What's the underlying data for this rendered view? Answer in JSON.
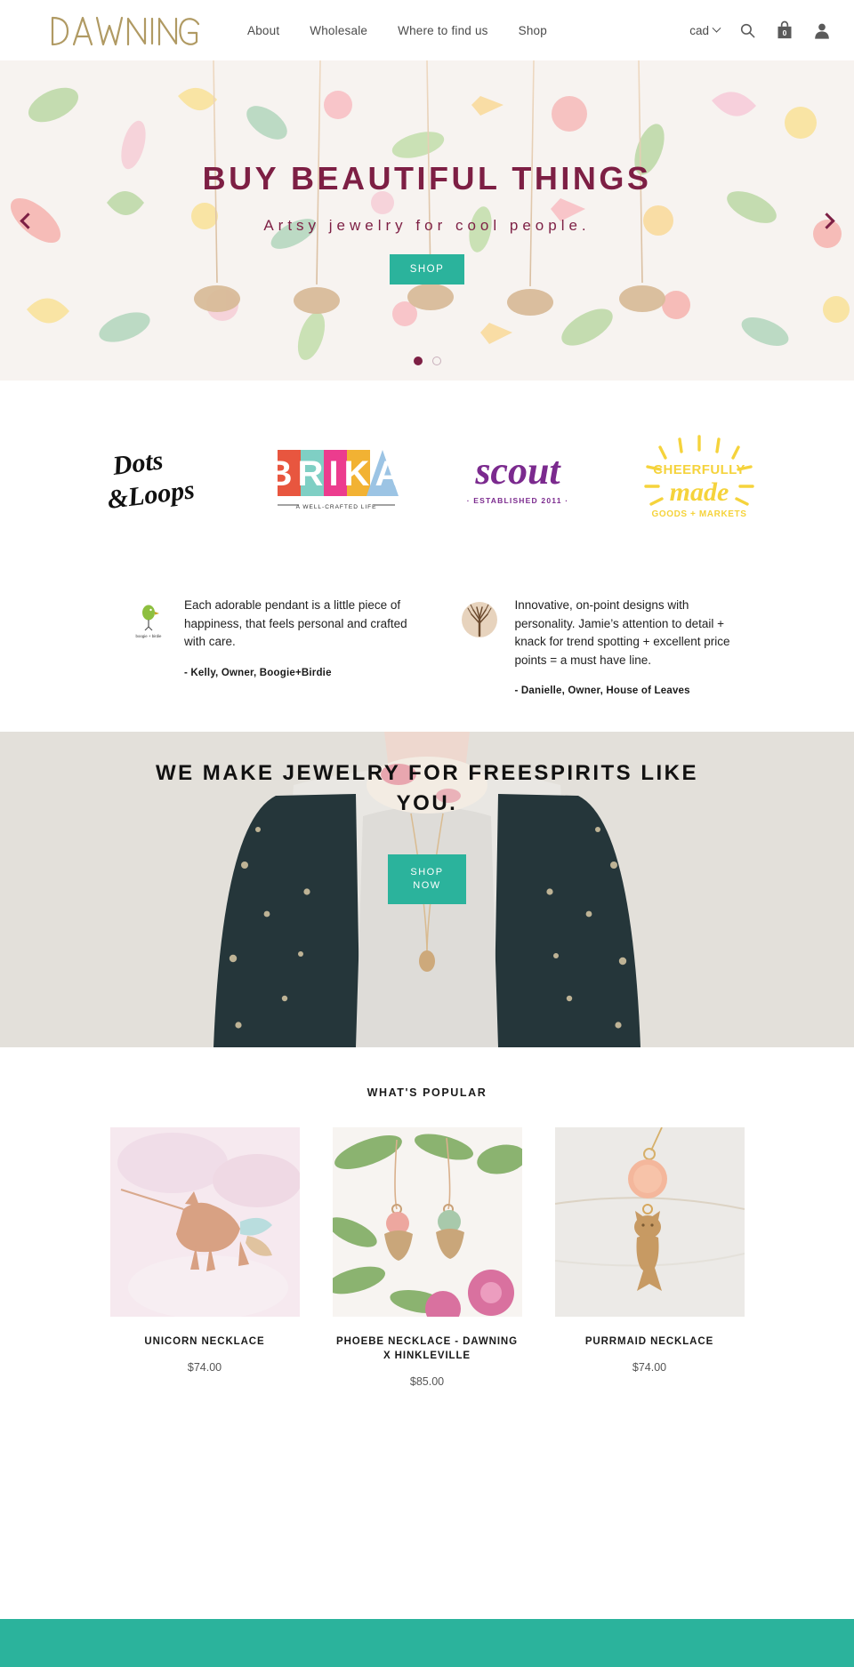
{
  "brand": {
    "name": "DAWNING"
  },
  "header": {
    "nav": [
      {
        "label": "About"
      },
      {
        "label": "Wholesale"
      },
      {
        "label": "Where to find us"
      },
      {
        "label": "Shop"
      }
    ],
    "currency": "cad",
    "icons": {
      "search": "search-icon",
      "cart": "shopping-bag-icon",
      "account": "user-account-icon"
    },
    "cart_count": "0"
  },
  "hero": {
    "title": "BUY BEAUTIFUL THINGS",
    "subtitle": "Artsy jewelry for cool people.",
    "button": "SHOP",
    "prev_icon": "chevron-left-icon",
    "next_icon": "chevron-right-icon",
    "slides": 2,
    "active_slide": 1,
    "title_color": "#7d1f44",
    "button_color": "#2bb39c"
  },
  "press_logos": [
    {
      "name": "Dots & Loops",
      "line1": "Dots",
      "line2": "&Loops"
    },
    {
      "name": "BRIKA",
      "letters": "BRIKA",
      "tagline": "A WELL-CRAFTED LIFE"
    },
    {
      "name": "scout",
      "word": "scout",
      "tagline": "· ESTABLISHED 2011 ·"
    },
    {
      "name": "Cheerfully Made",
      "line1": "CHEERFULLY",
      "line2": "made",
      "line3": "GOODS + MARKETS"
    }
  ],
  "testimonials": [
    {
      "quote": "Each adorable pendant is a little piece of happiness, that feels personal and crafted with care.",
      "author": "- Kelly, Owner, Boogie+Birdie",
      "avatar": "boogie-birdie-logo",
      "avatar_caption": "boogie + birdie"
    },
    {
      "quote": "Innovative, on-point designs with personality. Jamie’s attention to detail + knack for trend spotting + excellent price points = a must have line.",
      "author": "- Danielle, Owner, House of Leaves",
      "avatar": "house-of-leaves-tree-logo"
    }
  ],
  "lifestyle": {
    "title": "WE MAKE JEWELRY FOR FREESPIRITS LIKE YOU.",
    "button_line1": "SHOP",
    "button_line2": "NOW"
  },
  "products": {
    "heading": "WHAT'S POPULAR",
    "items": [
      {
        "title": "UNICORN NECKLACE",
        "price": "$74.00",
        "image": "rose-gold-unicorn-pendant-on-pink"
      },
      {
        "title": "PHOEBE NECKLACE - DAWNING X HINKLEVILLE",
        "price": "$85.00",
        "image": "two-bell-pendants-with-flowers"
      },
      {
        "title": "PURRMAID NECKLACE",
        "price": "$74.00",
        "image": "gold-cat-mermaid-pendant-on-marble"
      }
    ]
  },
  "footer": {
    "band_color": "#2bb39c"
  }
}
